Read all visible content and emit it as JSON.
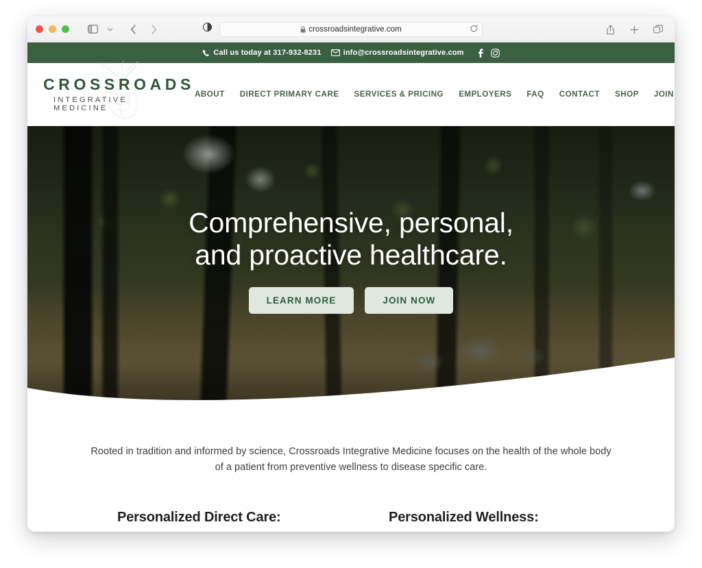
{
  "browser": {
    "url": "crossroadsintegrative.com",
    "icons": {
      "lock": "lock-icon",
      "reload": "reload-icon",
      "sidebar": "sidebar-toggle-icon",
      "sidebar_chevron": "chevron-down-icon",
      "back": "back-arrow-icon",
      "forward": "forward-arrow-icon",
      "reader": "reader-mode-icon",
      "share": "share-icon",
      "new_tab": "plus-icon",
      "tab_overview": "tab-overview-icon"
    }
  },
  "topbar": {
    "phone_label": "Call us today at 317-932-8231",
    "email_label": "info@crossroadsintegrative.com",
    "phone_icon": "phone-icon",
    "email_icon": "envelope-icon",
    "facebook_icon": "facebook-icon",
    "instagram_icon": "instagram-icon",
    "background": "#3a6041"
  },
  "header": {
    "logo_main": "CROSSROADS",
    "logo_sub": "INTEGRATIVE MEDICINE",
    "logo_watermark": "anatomical-heart-leaves-icon",
    "nav": [
      {
        "label": "ABOUT"
      },
      {
        "label": "DIRECT PRIMARY CARE"
      },
      {
        "label": "SERVICES & PRICING"
      },
      {
        "label": "EMPLOYERS"
      },
      {
        "label": "FAQ"
      },
      {
        "label": "CONTACT"
      },
      {
        "label": "SHOP"
      },
      {
        "label": "JOIN NOW"
      }
    ]
  },
  "hero": {
    "title_line1": "Comprehensive, personal,",
    "title_line2": "and proactive healthcare.",
    "buttons": [
      {
        "label": "LEARN MORE"
      },
      {
        "label": "JOIN NOW"
      }
    ],
    "image_alt": "sunlit-forest-photo",
    "button_bg": "#dfe7de",
    "button_text_color": "#2f5b40"
  },
  "intro": {
    "paragraph": "Rooted in tradition and informed by science, Crossroads Integrative Medicine focuses on the health of the whole body of a patient from preventive wellness to disease specific care.",
    "columns": [
      {
        "heading": "Personalized Direct Care:"
      },
      {
        "heading": "Personalized Wellness:"
      }
    ]
  },
  "theme": {
    "brand_green": "#2e5738",
    "nav_green": "#44624a",
    "topbar_green": "#3a6041"
  }
}
